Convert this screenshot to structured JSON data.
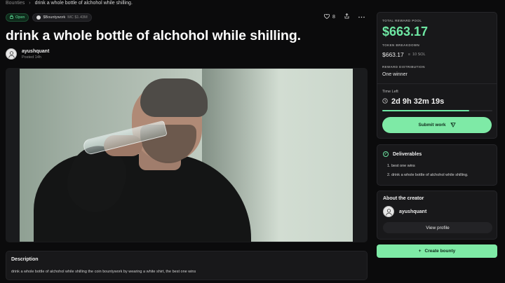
{
  "breadcrumb": {
    "root": "Bounties",
    "current": "drink a whole bottle of alchohol while shilling."
  },
  "badges": {
    "status": "Open",
    "token": "$Bountywork",
    "market_cap": "MC $1.43M"
  },
  "actions": {
    "likes": "8"
  },
  "bounty": {
    "title": "drink a whole bottle of alchohol while shilling."
  },
  "author": {
    "name": "ayushquant",
    "posted": "Posted 14h"
  },
  "description": {
    "title": "Description",
    "body": "drink a whole bottle of alchohol while shilling the coin bountywork by wearing a white shirt, the best one wins"
  },
  "reward": {
    "pool_label": "TOTAL REWARD POOL",
    "pool_value": "$663.17",
    "breakdown_label": "TOKEN BREAKDOWN",
    "breakdown_usd": "$663.17",
    "breakdown_sol": "10 SOL",
    "distribution_label": "REWARD DISTRIBUTION",
    "distribution_value": "One winner",
    "time_left_label": "Time Left",
    "time_left_value": "2d 9h 32m 19s",
    "time_progress": 0.79,
    "submit_label": "Submit work"
  },
  "deliverables": {
    "title": "Deliverables",
    "items": [
      "1.  best one wins",
      "2.  drink a whole bottle of alchohol while shilling."
    ]
  },
  "creator": {
    "title": "About the creator",
    "name": "ayushquant",
    "view_profile": "View profile"
  },
  "create_bounty": "Create bounty",
  "colors": {
    "accent": "#6ee7a3",
    "button": "#7eeaa6",
    "background": "#0b0b0c",
    "card": "#18181a"
  }
}
